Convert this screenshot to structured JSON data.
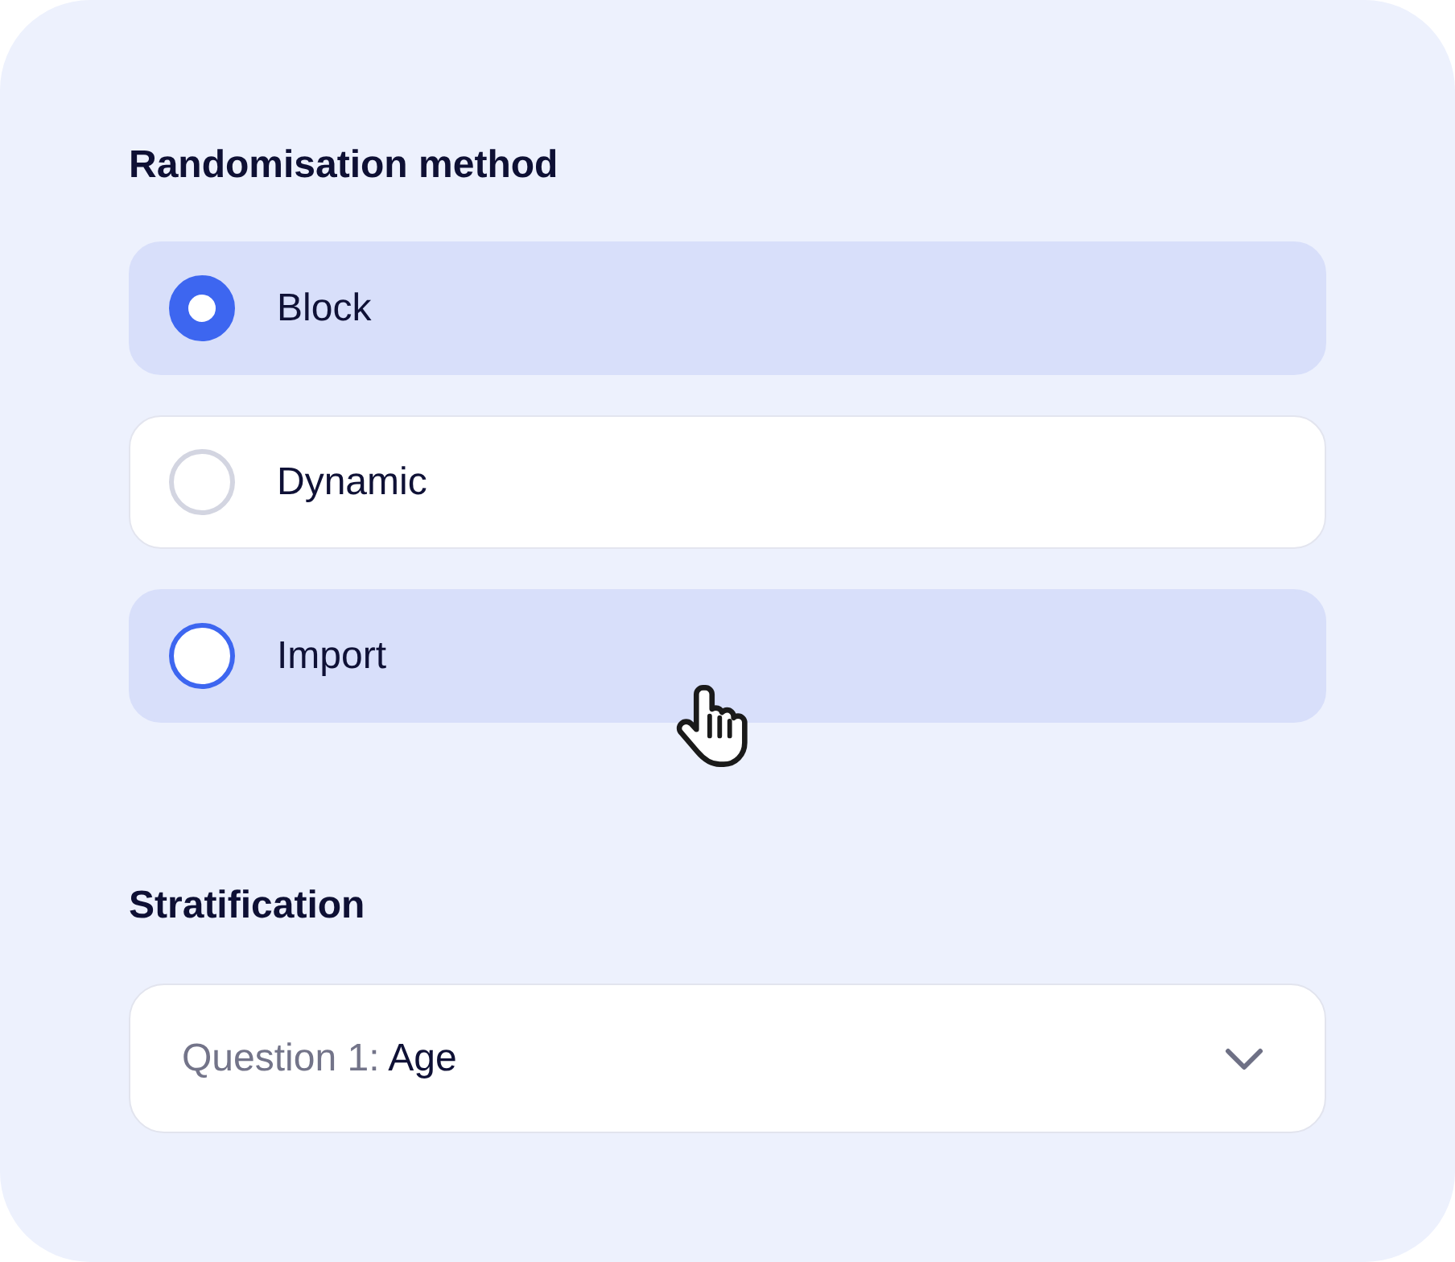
{
  "randomisation": {
    "heading": "Randomisation method",
    "options": [
      {
        "label": "Block",
        "selected": true,
        "hovered": false
      },
      {
        "label": "Dynamic",
        "selected": false,
        "hovered": false
      },
      {
        "label": "Import",
        "selected": false,
        "hovered": true
      }
    ]
  },
  "stratification": {
    "heading": "Stratification",
    "dropdown": {
      "label": "Question 1:",
      "value": "Age"
    }
  }
}
